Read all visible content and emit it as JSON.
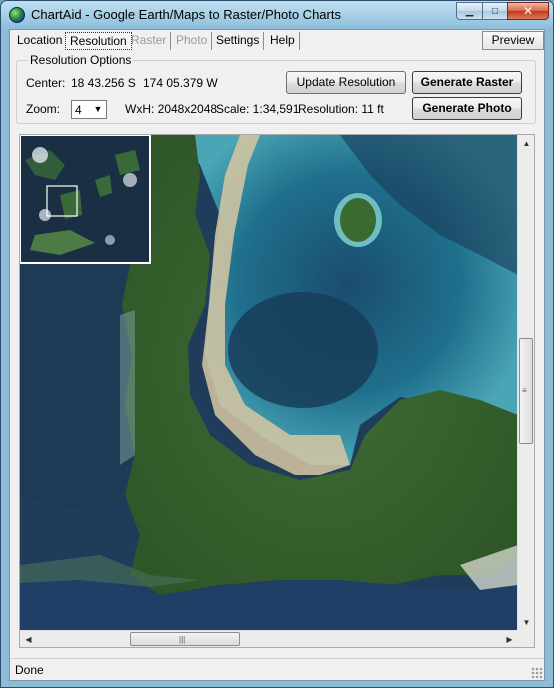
{
  "window": {
    "title": "ChartAid - Google Earth/Maps to Raster/Photo Charts",
    "minimize_glyph": "▁",
    "maximize_glyph": "□",
    "close_glyph": "✕"
  },
  "menu": {
    "items": [
      {
        "label": "Location",
        "state": "normal"
      },
      {
        "label": "Resolution",
        "state": "active"
      },
      {
        "label": "Raster",
        "state": "disabled"
      },
      {
        "label": "Photo",
        "state": "disabled"
      },
      {
        "label": "Settings",
        "state": "normal"
      },
      {
        "label": "Help",
        "state": "normal"
      }
    ],
    "preview_label": "Preview"
  },
  "resolution": {
    "group_title": "Resolution Options",
    "center_label": "Center:",
    "center_lat": "18 43.256 S",
    "center_lon": "174 05.379 W",
    "zoom_label": "Zoom:",
    "zoom_value": "4",
    "size_text": "WxH: 2048x2048",
    "scale_text": "Scale: 1:34,591",
    "resolution_text": "Resolution: 11 ft",
    "update_button": "Update Resolution",
    "generate_raster_button": "Generate Raster",
    "generate_photo_button": "Generate Photo"
  },
  "scrollbars": {
    "vertical_up_glyph": "▲",
    "vertical_down_glyph": "▼",
    "horizontal_left_glyph": "◀",
    "horizontal_right_glyph": "▶",
    "vertical_grip": "≡",
    "horizontal_grip": "|||"
  },
  "status": {
    "text": "Done"
  },
  "colors": {
    "deep_water": "#1f3d5b",
    "lagoon": "#1f6f8c",
    "shallow": "#58b0bd",
    "forest": "#3d6b31",
    "sand": "#d8c7a2"
  }
}
